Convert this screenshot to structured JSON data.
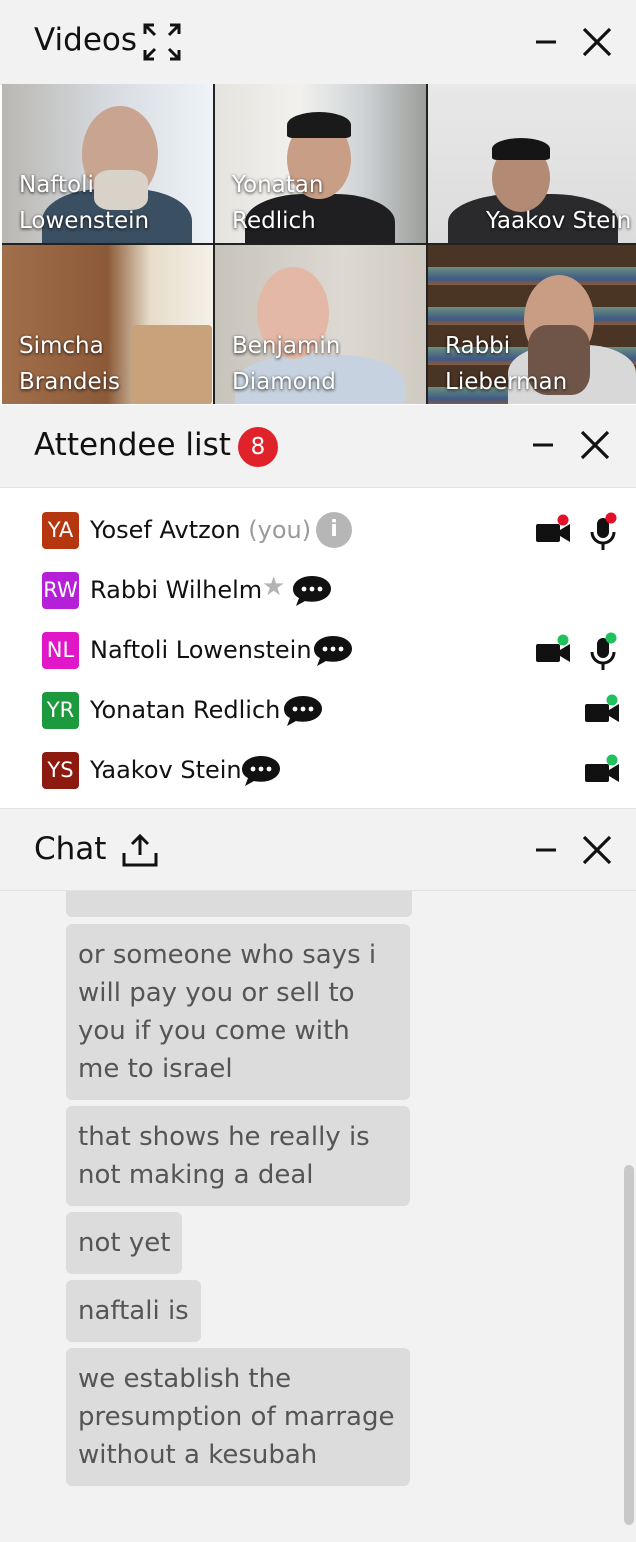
{
  "videos": {
    "title": "Videos",
    "tiles": [
      {
        "name": "Naftoli\nLowenstein"
      },
      {
        "name": "Yonatan\nRedlich"
      },
      {
        "name": "Yaakov Stein"
      },
      {
        "name": "Simcha\nBrandeis"
      },
      {
        "name": "Benjamin\nDiamond"
      },
      {
        "name": "Rabbi\nLieberman"
      }
    ]
  },
  "attendees": {
    "title": "Attendee list",
    "count": "8",
    "rows": [
      {
        "initials": "YA",
        "name": "Yosef Avtzon",
        "suffix": "(you)",
        "color": "#b5360f"
      },
      {
        "initials": "RW",
        "name": "Rabbi Wilhelm",
        "color": "#b51fd8"
      },
      {
        "initials": "NL",
        "name": "Naftoli Lowenstein",
        "color": "#e016c8"
      },
      {
        "initials": "YR",
        "name": "Yonatan Redlich",
        "color": "#1e9a3e"
      },
      {
        "initials": "YS",
        "name": "Yaakov Stein",
        "color": "#8c1a0f"
      }
    ]
  },
  "chat": {
    "title": "Chat",
    "messages": [
      "or someone who says i will pay you or sell to you if you come with me to israel",
      "that shows he really is not making a deal",
      "not yet",
      "naftali is",
      "we establish the presumption of marrage without a kesubah"
    ]
  },
  "colors": {
    "badge": "#e0232b",
    "status_on": "#1fc15c",
    "status_off": "#e3102a",
    "panel_bg": "#f2f2f2",
    "bubble_bg": "#dcdcdc"
  }
}
